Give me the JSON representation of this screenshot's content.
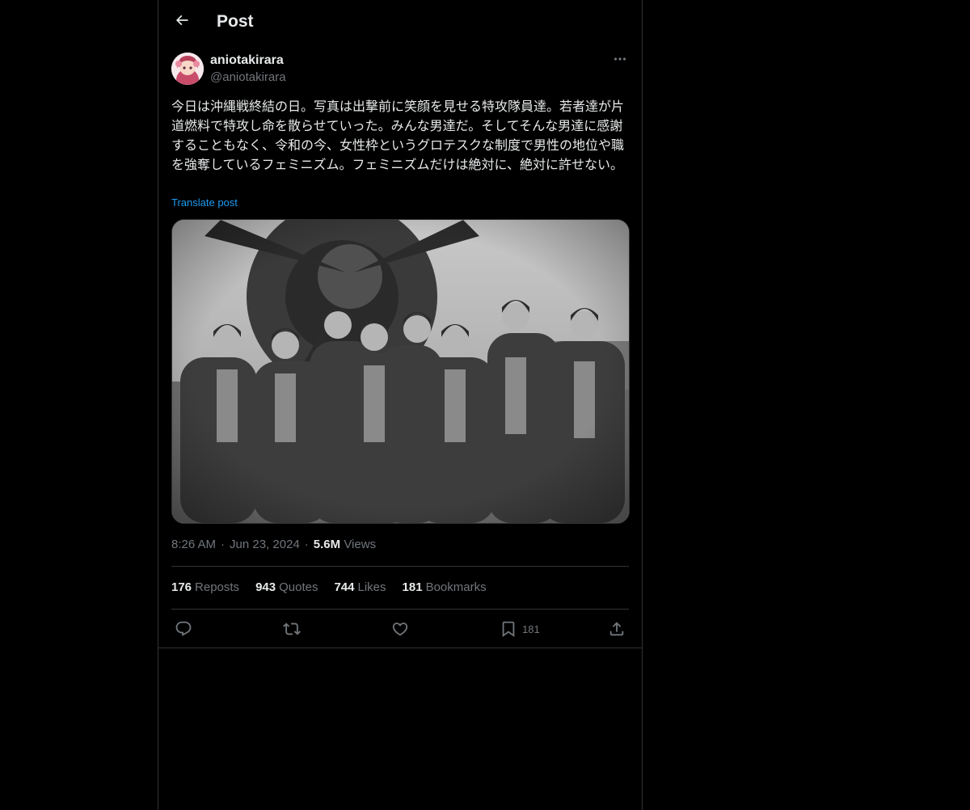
{
  "header": {
    "title": "Post",
    "back_icon": "arrow-left-icon"
  },
  "post": {
    "author": {
      "name": "aniotakirara",
      "handle": "@aniotakirara"
    },
    "text": "今日は沖縄戦終結の日。写真は出撃前に笑顔を見せる特攻隊員達。若者達が片道燃料で特攻し命を散らせていった。みんな男達だ。そしてそんな男達に感謝することもなく、令和の今、女性枠というグロテスクな制度で男性の地位や職を強奪しているフェミニズム。フェミニズムだけは絶対に、絶対に許せない。",
    "translate_label": "Translate post",
    "media_description": "black-and-white photo",
    "time": "8:26 AM",
    "date": "Jun 23, 2024",
    "views_count": "5.6M",
    "views_label": "Views"
  },
  "stats": [
    {
      "count": "176",
      "label": "Reposts"
    },
    {
      "count": "943",
      "label": "Quotes"
    },
    {
      "count": "744",
      "label": "Likes"
    },
    {
      "count": "181",
      "label": "Bookmarks"
    }
  ],
  "actions": {
    "reply_icon": "reply-icon",
    "repost_icon": "repost-icon",
    "like_icon": "heart-icon",
    "bookmark_icon": "bookmark-icon",
    "bookmark_count": "181",
    "share_icon": "share-icon"
  },
  "colors": {
    "background": "#000000",
    "text_primary": "#e7e9ea",
    "text_secondary": "#71767b",
    "link": "#1d9bf0",
    "border": "#2f3336"
  }
}
